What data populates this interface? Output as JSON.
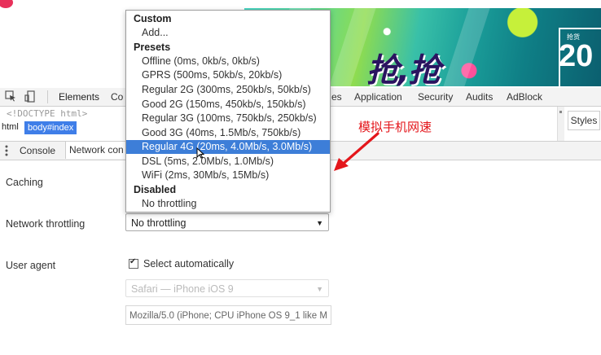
{
  "banner": {
    "title": "抢,抢",
    "badge_small": "抢货",
    "badge_number": "20"
  },
  "devtools": {
    "tabs": [
      "Elements",
      "Co",
      "es",
      "Application",
      "Security",
      "Audits",
      "AdBlock"
    ],
    "doctype": "<!DOCTYPE html>",
    "breadcrumb": {
      "html": "html",
      "body": "body#index"
    },
    "styles_tab": "Styles",
    "drawer_tabs": [
      "Console",
      "Network con"
    ]
  },
  "conditions": {
    "caching_label": "Caching",
    "throttling_label": "Network throttling",
    "throttling_value": "No throttling",
    "user_agent_label": "User agent",
    "select_auto_label": "Select automatically",
    "select_auto_checked": true,
    "ua_select_value": "Safari — iPhone iOS 9",
    "ua_string": "Mozilla/5.0 (iPhone; CPU iPhone OS 9_1 like M"
  },
  "dropdown": {
    "headers": [
      "Custom",
      "Presets",
      "Disabled"
    ],
    "items": [
      "Add...",
      "Offline (0ms, 0kb/s, 0kb/s)",
      "GPRS (500ms, 50kb/s, 20kb/s)",
      "Regular 2G (300ms, 250kb/s, 50kb/s)",
      "Good 2G (150ms, 450kb/s, 150kb/s)",
      "Regular 3G (100ms, 750kb/s, 250kb/s)",
      "Good 3G (40ms, 1.5Mb/s, 750kb/s)",
      "Regular 4G (20ms, 4.0Mb/s, 3.0Mb/s)",
      "DSL (5ms, 2.0Mb/s, 1.0Mb/s)",
      "WiFi (2ms, 30Mb/s, 15Mb/s)",
      "No throttling"
    ],
    "selected": "Regular 4G (20ms, 4.0Mb/s, 3.0Mb/s)"
  },
  "annotation": {
    "text": "模拟手机网速",
    "color": "#e4161b"
  },
  "colors": {
    "selection": "#3d7ed8",
    "breadcrumb": "#3f7ee8"
  },
  "icons": [
    "inspect-icon",
    "device-toolbar-icon",
    "kebab-menu-icon",
    "chevron-down-icon",
    "checkbox-check-icon",
    "mouse-cursor-icon",
    "red-arrow-icon"
  ]
}
